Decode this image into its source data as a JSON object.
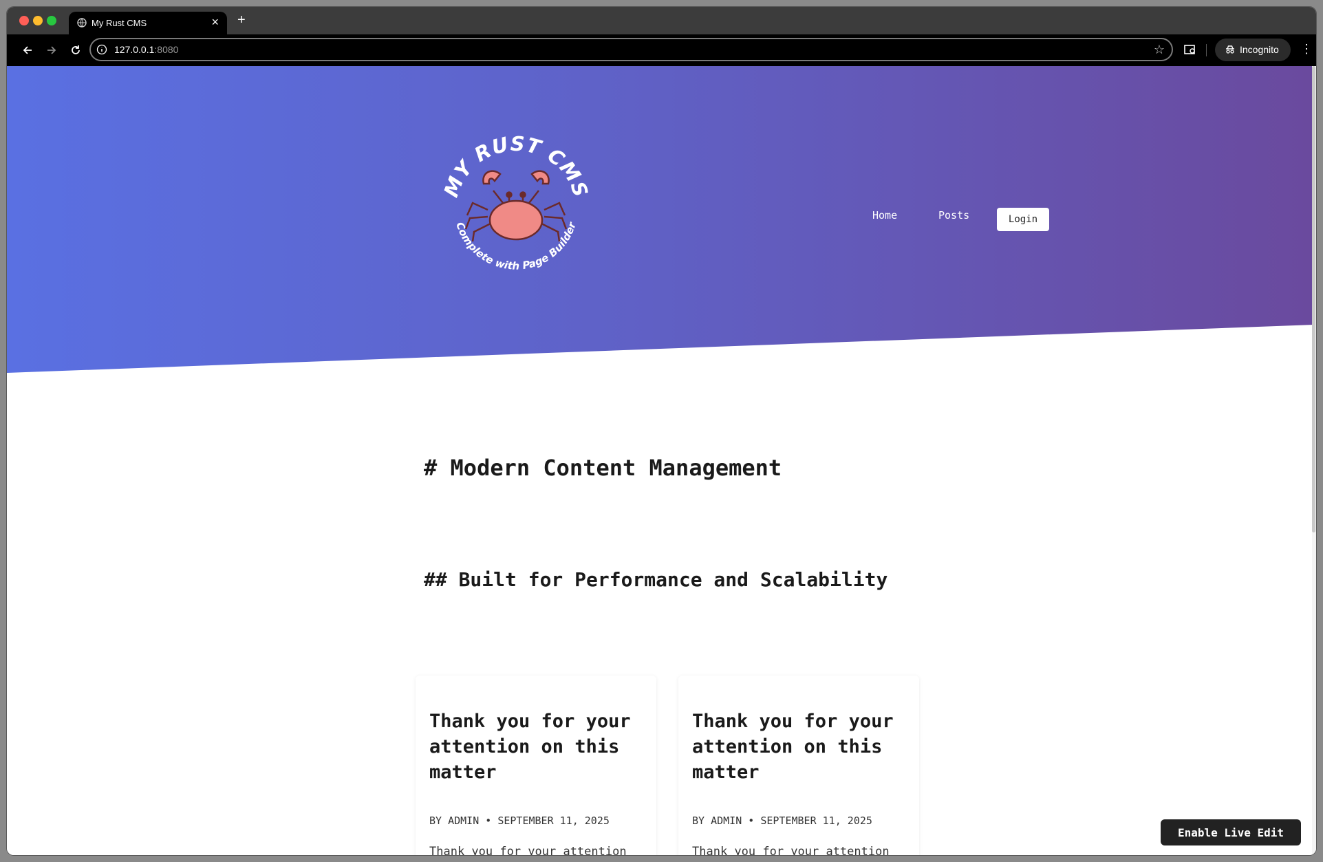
{
  "browser": {
    "tab_title": "My Rust CMS",
    "new_tab_label": "+",
    "close_tab_label": "×",
    "url_host": "127.0.0.1",
    "url_port": ":8080",
    "incognito_label": "Incognito",
    "menu_label": "⋮",
    "star_label": "☆"
  },
  "site": {
    "logo_top_text": "MY RUST CMS",
    "logo_bottom_text": "Complete with Page Builder",
    "nav": {
      "home": "Home",
      "posts": "Posts",
      "login": "Login"
    },
    "colors": {
      "hero_start": "#5a70e2",
      "hero_end": "#6a4a9e",
      "crab": "#f08a86"
    }
  },
  "content": {
    "heading1": "# Modern Content Management",
    "heading2": "## Built for Performance and Scalability",
    "cards": [
      {
        "title": "Thank you for your attention on this matter",
        "meta": "BY ADMIN • SEPTEMBER 11, 2025",
        "excerpt": "Thank you for your attention"
      },
      {
        "title": "Thank you for your attention on this matter",
        "meta": "BY ADMIN • SEPTEMBER 11, 2025",
        "excerpt": "Thank you for your attention"
      }
    ]
  },
  "live_edit": {
    "label": "Enable Live Edit"
  }
}
